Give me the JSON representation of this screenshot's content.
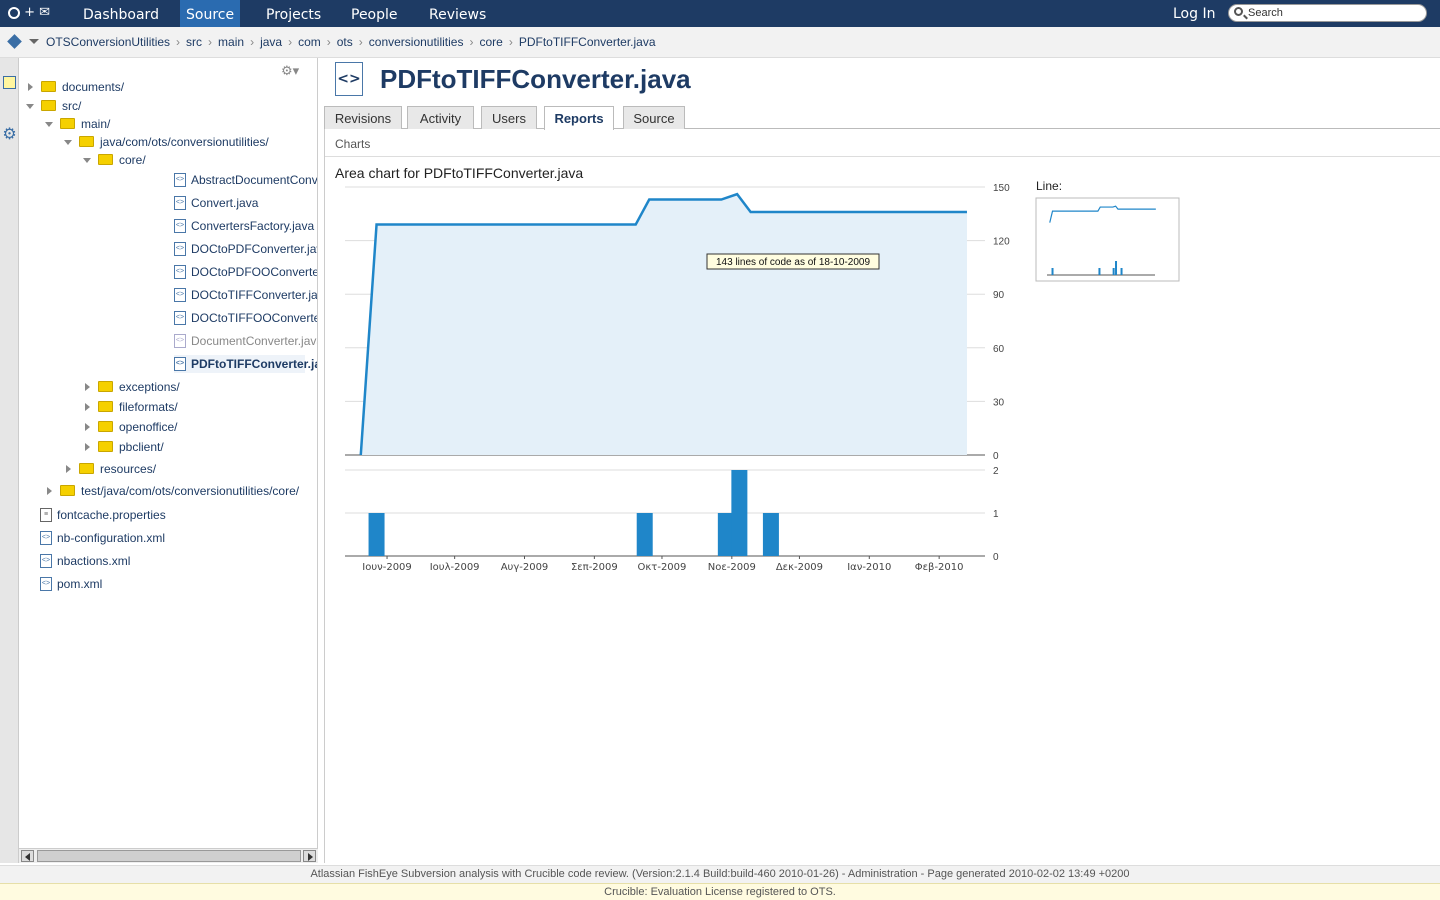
{
  "topbar": {
    "nav": [
      "Dashboard",
      "Source",
      "Projects",
      "People",
      "Reviews"
    ],
    "active": "Source",
    "login": "Log In",
    "search_placeholder": "Search"
  },
  "breadcrumb": [
    "OTSConversionUtilities",
    "src",
    "main",
    "java",
    "com",
    "ots",
    "conversionutilities",
    "core",
    "PDFtoTIFFConverter.java"
  ],
  "tree": [
    {
      "label": "documents/",
      "type": "folder",
      "depth": 0,
      "state": "closed"
    },
    {
      "label": "src/",
      "type": "folder",
      "depth": 0,
      "state": "open"
    },
    {
      "label": "main/",
      "type": "folder",
      "depth": 1,
      "state": "open"
    },
    {
      "label": "java/com/ots/conversionutilities/",
      "type": "folder",
      "depth": 2,
      "state": "open"
    },
    {
      "label": "core/",
      "type": "folder",
      "depth": 3,
      "state": "open"
    },
    {
      "label": "AbstractDocumentConverter.java",
      "type": "file",
      "depth": 4
    },
    {
      "label": "Convert.java",
      "type": "file",
      "depth": 4
    },
    {
      "label": "ConvertersFactory.java",
      "type": "file",
      "depth": 4
    },
    {
      "label": "DOCtoPDFConverter.java",
      "type": "file",
      "depth": 4
    },
    {
      "label": "DOCtoPDFOOConverter.java",
      "type": "file",
      "depth": 4
    },
    {
      "label": "DOCtoTIFFConverter.java",
      "type": "file",
      "depth": 4
    },
    {
      "label": "DOCtoTIFFOOConverter.java",
      "type": "file",
      "depth": 4
    },
    {
      "label": "DocumentConverter.java",
      "type": "file",
      "depth": 4,
      "dim": true
    },
    {
      "label": "PDFtoTIFFConverter.java",
      "type": "file",
      "depth": 4,
      "selected": true
    },
    {
      "label": "exceptions/",
      "type": "folder",
      "depth": 3,
      "state": "closed"
    },
    {
      "label": "fileformats/",
      "type": "folder",
      "depth": 3,
      "state": "closed"
    },
    {
      "label": "openoffice/",
      "type": "folder",
      "depth": 3,
      "state": "closed"
    },
    {
      "label": "pbclient/",
      "type": "folder",
      "depth": 3,
      "state": "closed"
    },
    {
      "label": "resources/",
      "type": "folder",
      "depth": 2,
      "state": "closed"
    },
    {
      "label": "test/java/com/ots/conversionutilities/core/",
      "type": "folder",
      "depth": 1,
      "state": "closed"
    },
    {
      "label": "fontcache.properties",
      "type": "textfile",
      "depth": 0
    },
    {
      "label": "nb-configuration.xml",
      "type": "file",
      "depth": 0
    },
    {
      "label": "nbactions.xml",
      "type": "file",
      "depth": 0
    },
    {
      "label": "pom.xml",
      "type": "file",
      "depth": 0
    }
  ],
  "file": {
    "title": "PDFtoTIFFConverter.java",
    "tabs": [
      "Revisions",
      "Activity",
      "Users",
      "Reports",
      "Source"
    ],
    "active_tab": "Reports"
  },
  "charts_section": "Charts",
  "line_label": "Line:",
  "footer": {
    "line1": "Atlassian FishEye Subversion analysis with Crucible code review. (Version:2.1.4 Build:build-460 2010-01-26) - Administration - Page generated 2010-02-02 13:49 +0200",
    "line2": "Crucible: Evaluation License registered to OTS."
  },
  "colors": {
    "accent": "#1e3b64",
    "series": "#1f86c9",
    "area": "#e4f0f9",
    "tab_active": "#2a6bb0"
  },
  "chart_data": [
    {
      "type": "area",
      "title": "Area chart for PDFtoTIFFConverter.java",
      "x_ticks": [
        "Ιουν-2009",
        "Ιουλ-2009",
        "Αυγ-2009",
        "Σεπ-2009",
        "Οκτ-2009",
        "Νοε-2009",
        "Δεκ-2009",
        "Ιαν-2010",
        "Φεβ-2010"
      ],
      "x_range": [
        "2009-05-20",
        "2010-02-28"
      ],
      "y_ticks": [
        0,
        30,
        60,
        90,
        120,
        150
      ],
      "ylim": [
        0,
        150
      ],
      "series": [
        {
          "x": [
            "2009-05-27",
            "2009-06-03",
            "2009-09-26",
            "2009-10-02",
            "2009-11-03",
            "2009-11-10",
            "2009-11-16",
            "2010-02-20"
          ],
          "y": [
            0,
            129,
            129,
            143,
            143,
            146,
            136,
            136
          ]
        }
      ],
      "tooltip": "143 lines of code as of 18-10-2009",
      "grid": true
    },
    {
      "type": "bar",
      "y_ticks": [
        0,
        1,
        2
      ],
      "ylim": [
        0,
        2
      ],
      "x": [
        "2009-06-03",
        "2009-09-30",
        "2009-11-05",
        "2009-11-11",
        "2009-11-25"
      ],
      "values": [
        1,
        1,
        1,
        2,
        1
      ]
    }
  ]
}
